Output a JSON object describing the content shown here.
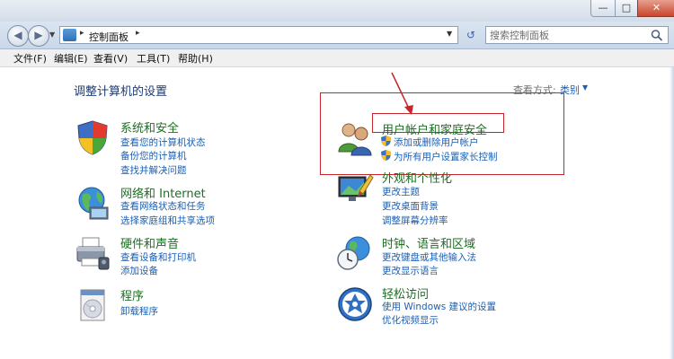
{
  "window": {
    "controls": {
      "minimize": "—",
      "maximize": "□",
      "close": "✕"
    }
  },
  "nav": {
    "back": "◀",
    "forward": "▶",
    "history_arrow": "▼",
    "address_sep": "▸",
    "address": "控制面板",
    "address_trail_sep": "▸",
    "address_dropdown": "▼",
    "refresh": "↺",
    "search_placeholder": "搜索控制面板"
  },
  "menu": {
    "file": "文件(F)",
    "edit": "编辑(E)",
    "view": "查看(V)",
    "tools": "工具(T)",
    "help": "帮助(H)"
  },
  "main": {
    "title": "调整计算机的设置",
    "view_by_label": "查看方式:",
    "view_by_value": "类别",
    "view_by_arrow": "▼",
    "categories_left": [
      {
        "title": "系统和安全",
        "icon": "shield-icon",
        "links": [
          "查看您的计算机状态",
          "备份您的计算机",
          "查找并解决问题"
        ]
      },
      {
        "title": "网络和 Internet",
        "icon": "network-globe-icon",
        "links": [
          "查看网络状态和任务",
          "选择家庭组和共享选项"
        ]
      },
      {
        "title": "硬件和声音",
        "icon": "printer-icon",
        "links": [
          "查看设备和打印机",
          "添加设备"
        ]
      },
      {
        "title": "程序",
        "icon": "programs-icon",
        "links": [
          "卸载程序"
        ]
      }
    ],
    "categories_right": [
      {
        "title": "用户帐户和家庭安全",
        "icon": "users-icon",
        "links": [
          "添加或删除用户帐户",
          "为所有用户设置家长控制"
        ]
      },
      {
        "title": "外观和个性化",
        "icon": "appearance-icon",
        "links": [
          "更改主题",
          "更改桌面背景",
          "调整屏幕分辨率"
        ]
      },
      {
        "title": "时钟、语言和区域",
        "icon": "clock-globe-icon",
        "links": [
          "更改键盘或其他输入法",
          "更改显示语言"
        ]
      },
      {
        "title": "轻松访问",
        "icon": "ease-of-access-icon",
        "links": [
          "使用 Windows 建议的设置",
          "优化视频显示"
        ]
      }
    ]
  },
  "colors": {
    "annotation": "#c6252b",
    "link": "#1a5fb4",
    "category_title": "#1c6e22",
    "page_title": "#1c3a72"
  }
}
